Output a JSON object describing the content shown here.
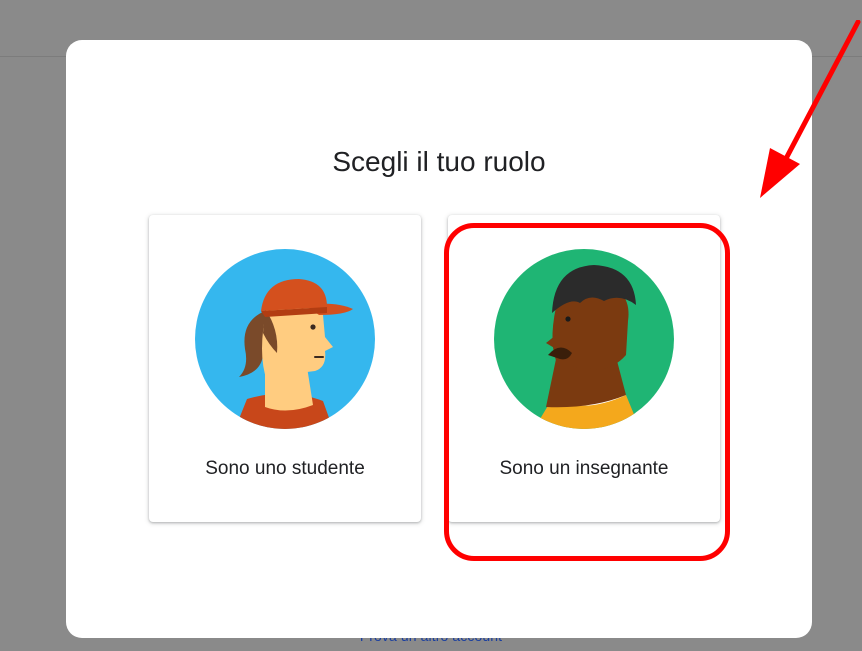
{
  "backdrop": {
    "link_label": "Prova un altro account"
  },
  "dialog": {
    "title": "Scegli il tuo ruolo",
    "roles": [
      {
        "label": "Sono uno studente",
        "icon": "student-avatar-icon"
      },
      {
        "label": "Sono un insegnante",
        "icon": "teacher-avatar-icon"
      }
    ]
  },
  "colors": {
    "backdrop": "#8a8a8a",
    "annotation_red": "#ff0000",
    "student_bg": "#35b7ee",
    "teacher_bg": "#1fb574"
  }
}
